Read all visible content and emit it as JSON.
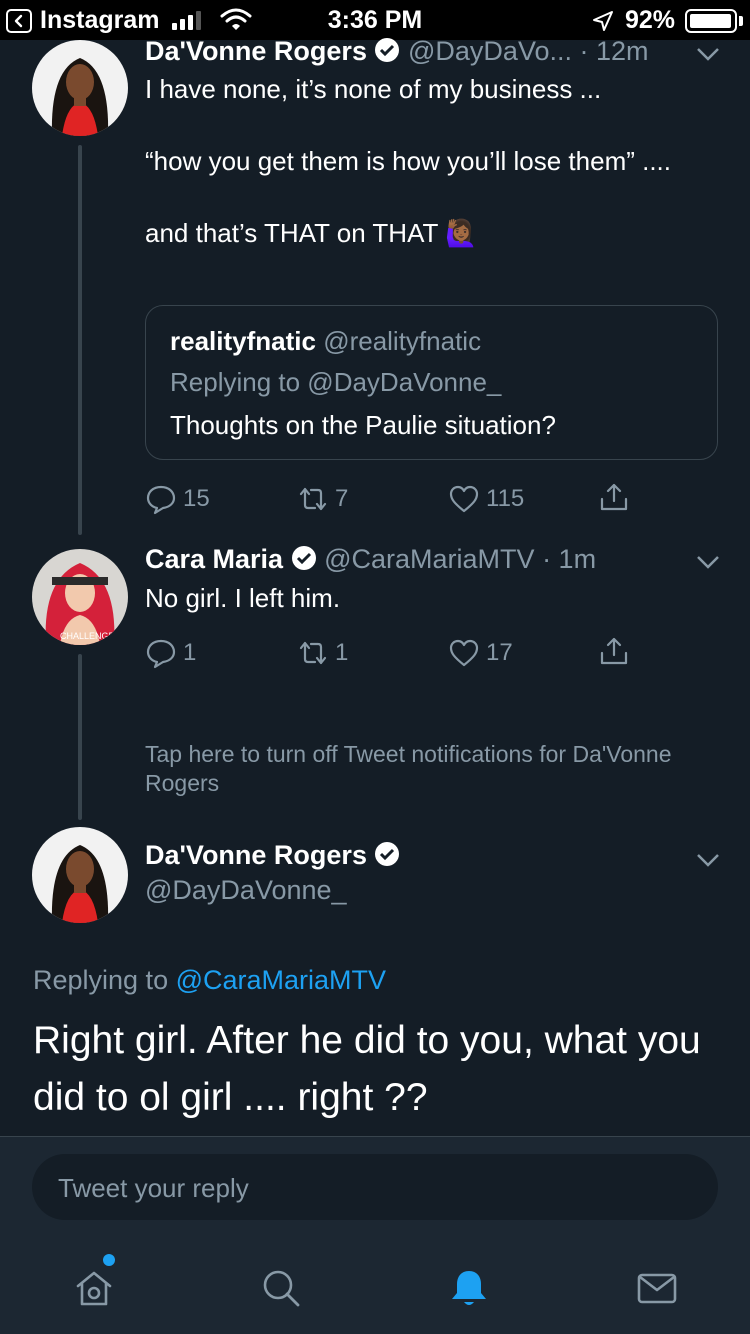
{
  "status_bar": {
    "back_app": "Instagram",
    "time": "3:36 PM",
    "battery": "92%",
    "icons": [
      "back-chevron-icon",
      "signal-icon",
      "wifi-icon",
      "location-arrow-icon",
      "battery-icon"
    ]
  },
  "tweets": [
    {
      "name": "Da'Vonne Rogers",
      "handle": "@DayDaVo...",
      "time": "· 12m",
      "verified": true,
      "text": "I have none, it’s none of my business ...\n\n “how you get them is how you’ll lose them” ....\n\nand that’s THAT on THAT 🙋🏾‍♀️",
      "quoted": {
        "name": "realityfnatic",
        "handle": "@realityfnatic",
        "replying": "Replying to @DayDaVonne_",
        "text": "Thoughts on the Paulie situation?"
      },
      "actions": {
        "replies": "15",
        "retweets": "7",
        "likes": "115"
      }
    },
    {
      "name": "Cara Maria",
      "handle": "@CaraMariaMTV",
      "time": "· 1m",
      "verified": true,
      "text": "No girl. I left him.",
      "actions": {
        "replies": "1",
        "retweets": "1",
        "likes": "17"
      }
    }
  ],
  "notification_prompt": "Tap here to turn off Tweet notifications for Da'Vonne Rogers",
  "focused_tweet": {
    "name": "Da'Vonne Rogers",
    "handle": "@DayDaVonne_",
    "replying_prefix": "Replying to",
    "replying_handle": "@CaraMariaMTV",
    "text": "Right girl. After he did to you, what you did to ol girl .... right ??"
  },
  "compose": {
    "placeholder": "Tweet your reply"
  },
  "tabbar": {
    "items": [
      "home-icon",
      "search-icon",
      "notifications-bell-icon",
      "messages-icon"
    ],
    "active": "notifications-bell-icon",
    "accent": "#1da1f2"
  },
  "colors": {
    "background": "#141d26",
    "secondary_text": "#8899a6",
    "border": "#38444d",
    "link": "#1da1f2"
  }
}
